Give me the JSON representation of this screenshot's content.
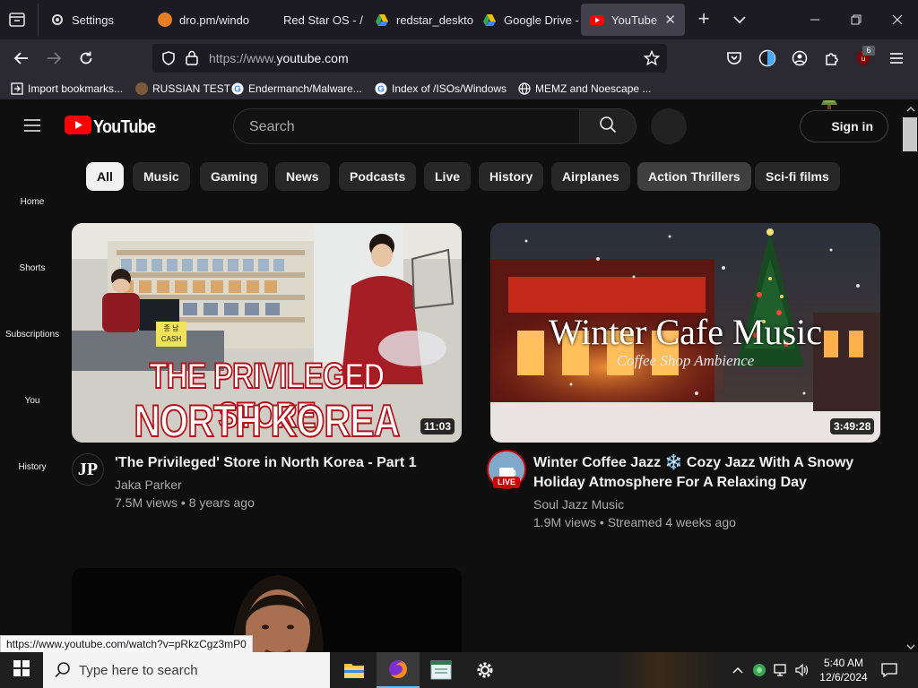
{
  "browser": {
    "tabs": [
      {
        "label": "Settings"
      },
      {
        "label": "dro.pm/windo"
      },
      {
        "label": "Red Star OS - /"
      },
      {
        "label": "redstar_deskto"
      },
      {
        "label": "Google Drive -"
      },
      {
        "label": "YouTube"
      }
    ],
    "url_dim": "https://www.",
    "url_main": "youtube.com",
    "extension_badge": "6",
    "bookmarks": [
      {
        "label": "Import bookmarks..."
      },
      {
        "label": "RUSSIAN TEST"
      },
      {
        "label": "Endermanch/Malware..."
      },
      {
        "label": "Index of /ISOs/Windows"
      },
      {
        "label": "MEMZ and Noescape ..."
      }
    ]
  },
  "youtube": {
    "logo_text": "YouTube",
    "search_placeholder": "Search",
    "signin_label": "Sign in",
    "chips": [
      "All",
      "Music",
      "Gaming",
      "News",
      "Podcasts",
      "Live",
      "History",
      "Airplanes",
      "Action Thrillers",
      "Sci-fi films"
    ],
    "sidebar": [
      "Home",
      "Shorts",
      "Subscriptions",
      "You",
      "History"
    ],
    "videos": [
      {
        "thumb_line1": "THE PRIVILEGED STORE",
        "thumb_line2": "NORTH KOREA",
        "sign_top": "종 남",
        "sign_bottom": "CASH",
        "duration": "11:03",
        "avatar_text": "JP",
        "title": "'The Privileged' Store in North Korea - Part 1",
        "channel": "Jaka Parker",
        "meta": "7.5M views • 8 years ago"
      },
      {
        "thumb_title": "Winter Cafe Music",
        "thumb_sub": "Coffee Shop Ambience",
        "duration": "3:49:28",
        "live_badge": "LIVE",
        "title_line1": "Winter Coffee Jazz ❄️ Cozy Jazz With A Snowy",
        "title_line2": "Holiday Atmosphere For A Relaxing Day",
        "channel": "Soul Jazz Music",
        "meta": "1.9M views • Streamed 4 weeks ago"
      }
    ]
  },
  "status_url": "https://www.youtube.com/watch?v=pRkzCgz3mP0",
  "taskbar": {
    "search_placeholder": "Type here to search",
    "time": "5:40 AM",
    "date": "12/6/2024"
  }
}
